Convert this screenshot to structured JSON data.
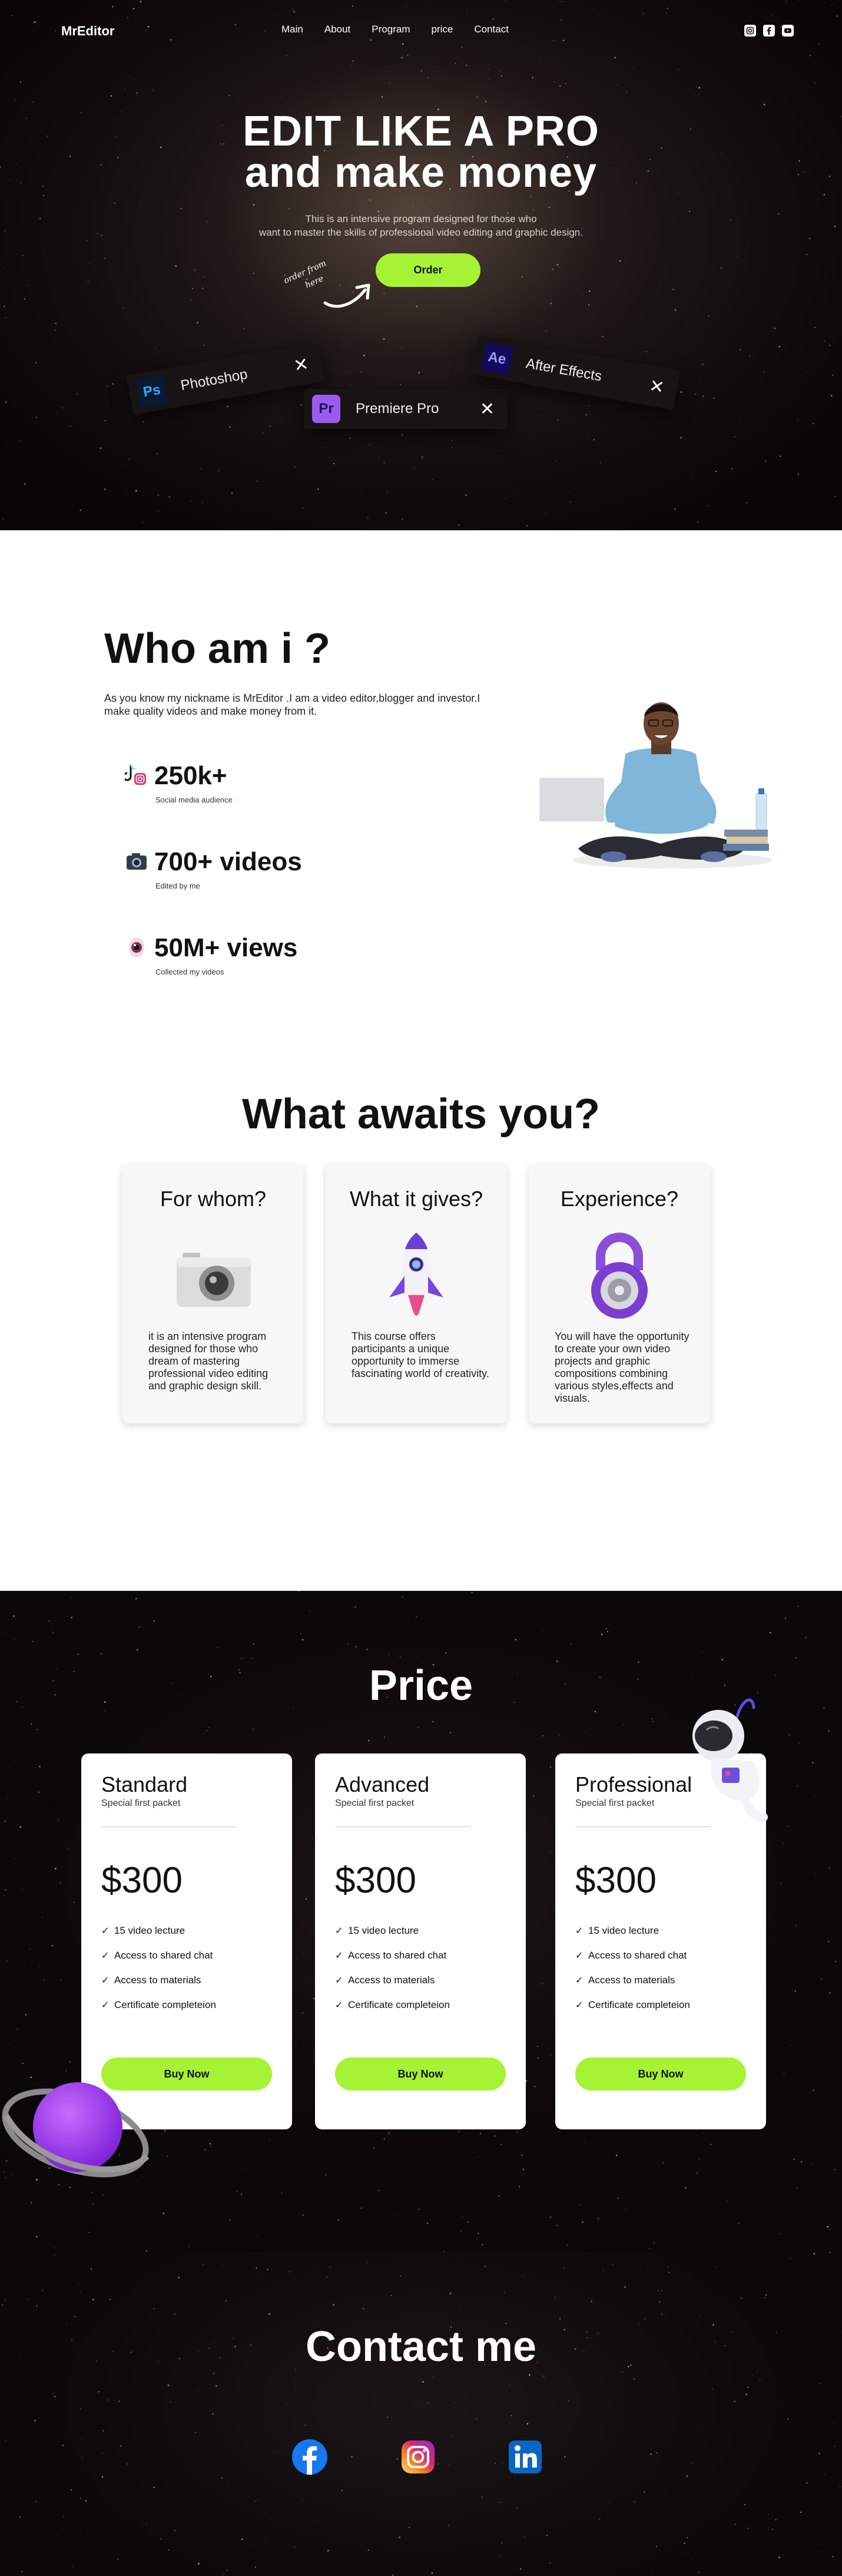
{
  "nav": {
    "logo": "MrEditor",
    "links": [
      "Main",
      "About",
      "Program",
      "price",
      "Contact"
    ],
    "social_icons": [
      "instagram-icon",
      "facebook-icon",
      "youtube-icon"
    ]
  },
  "hero": {
    "title_line1": "EDIT LIKE A PRO",
    "title_line2": "and make money",
    "subtitle_line1": "This is an intensive program designed for those who",
    "subtitle_line2": "want to master the skills of professional video editing and graphic design.",
    "order_button": "Order",
    "order_hint_line1": "order from",
    "order_hint_line2": "here",
    "tools": [
      {
        "badge": "Ps",
        "name": "Photoshop"
      },
      {
        "badge": "Pr",
        "name": "Premiere Pro"
      },
      {
        "badge": "Ae",
        "name": "After Effects"
      }
    ],
    "close_glyph": "✕"
  },
  "about": {
    "title": "Who am i ?",
    "bio": "As you know my nickname is MrEditor .I am a video editor,blogger and investor.I make quality videos and make money from it.",
    "stats": [
      {
        "value": "250k+",
        "label": "Social media audience",
        "icon": "social-media-icon"
      },
      {
        "value": "700+ videos",
        "label": "Edited by me",
        "icon": "camera-icon"
      },
      {
        "value": "50M+ views",
        "label": "Collected my videos",
        "icon": "eye-icon"
      }
    ]
  },
  "awaits": {
    "title": "What awaits you?",
    "cards": [
      {
        "title": "For whom?",
        "text": "it is an intensive program designed for those who dream of mastering professional video editing and graphic design skill.",
        "icon": "camera-icon"
      },
      {
        "title": "What it gives?",
        "text": "This course offers participants a unique opportunity to immerse fascinating world of creativity.",
        "icon": "rocket-icon"
      },
      {
        "title": "Experience?",
        "text": "You will have the opportunity to create your own video projects and graphic compositions combining various styles,effects and visuals.",
        "icon": "padlock-icon"
      }
    ]
  },
  "price": {
    "title": "Price",
    "plans": [
      {
        "name": "Standard",
        "sub": "Special first  packet",
        "amount": "$300",
        "button": "Buy Now"
      },
      {
        "name": "Advanced",
        "sub": "Special first  packet",
        "amount": "$300",
        "button": "Buy Now"
      },
      {
        "name": "Professional",
        "sub": "Special first  packet",
        "amount": "$300",
        "button": "Buy Now"
      }
    ],
    "features": [
      "15 video lecture",
      "Access to shared chat",
      "Access to materials",
      "Certificate completeion"
    ],
    "check_glyph": "✓"
  },
  "contact": {
    "title": "Contact me",
    "icons": [
      "facebook-icon",
      "instagram-icon",
      "linkedin-icon"
    ]
  },
  "colors": {
    "accent": "#a6f234",
    "dark_bg": "#0b0809",
    "white": "#ffffff",
    "facebook": "#1877f2",
    "linkedin": "#0a66c2"
  }
}
